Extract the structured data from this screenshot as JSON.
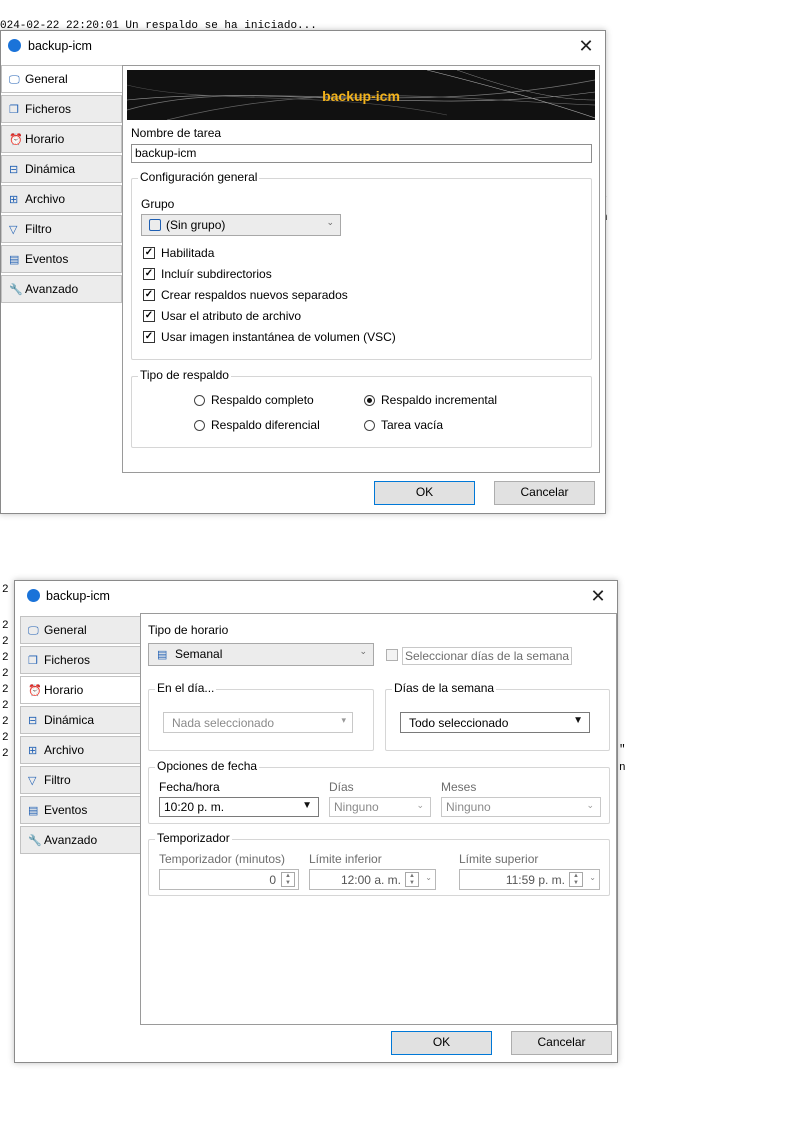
{
  "background_log": {
    "top_line": "024-02-22 22:20:01 Un respaldo se ha iniciado...",
    "right_fragments": [
      "\"",
      "n"
    ],
    "left_gutter_char": "2"
  },
  "dialog1": {
    "title": "backup-icm",
    "close_glyph": "✕",
    "tabs": [
      {
        "label": "General",
        "icon": "monitor-icon"
      },
      {
        "label": "Ficheros",
        "icon": "files-icon"
      },
      {
        "label": "Horario",
        "icon": "alarm-clock-icon"
      },
      {
        "label": "Dinámica",
        "icon": "dynamic-icon"
      },
      {
        "label": "Archivo",
        "icon": "archive-icon"
      },
      {
        "label": "Filtro",
        "icon": "filter-icon"
      },
      {
        "label": "Eventos",
        "icon": "calendar-icon"
      },
      {
        "label": "Avanzado",
        "icon": "wrench-icon"
      }
    ],
    "banner_text": "backup-icm",
    "task_name_label": "Nombre de tarea",
    "task_name_value": "backup-icm",
    "general_config": {
      "title": "Configuración general",
      "group_label": "Grupo",
      "group_value": "(Sin grupo)",
      "checkboxes": [
        {
          "label": "Habilitada",
          "checked": true
        },
        {
          "label": "Incluír subdirectorios",
          "checked": true
        },
        {
          "label": "Crear respaldos nuevos separados",
          "checked": true
        },
        {
          "label": "Usar el atributo de archivo",
          "checked": true
        },
        {
          "label": "Usar imagen instantánea de volumen (VSC)",
          "checked": true
        }
      ]
    },
    "backup_type": {
      "title": "Tipo de respaldo",
      "options": [
        {
          "label": "Respaldo completo",
          "selected": false
        },
        {
          "label": "Respaldo incremental",
          "selected": true
        },
        {
          "label": "Respaldo diferencial",
          "selected": false
        },
        {
          "label": "Tarea vacía",
          "selected": false
        }
      ]
    },
    "ok_label": "OK",
    "cancel_label": "Cancelar"
  },
  "dialog2": {
    "title": "backup-icm",
    "close_glyph": "✕",
    "tabs": [
      {
        "label": "General"
      },
      {
        "label": "Ficheros"
      },
      {
        "label": "Horario"
      },
      {
        "label": "Dinámica"
      },
      {
        "label": "Archivo"
      },
      {
        "label": "Filtro"
      },
      {
        "label": "Eventos"
      },
      {
        "label": "Avanzado"
      }
    ],
    "schedule_type_label": "Tipo de horario",
    "schedule_type_value": "Semanal",
    "select_weekdays_label": "Seleccionar días de la semana",
    "on_day": {
      "title": "En el día...",
      "value": "Nada seleccionado"
    },
    "weekdays": {
      "title": "Días de la semana",
      "value": "Todo seleccionado"
    },
    "date_options": {
      "title": "Opciones de fecha",
      "datetime_label": "Fecha/hora",
      "datetime_value": "10:20 p. m.",
      "days_label": "Días",
      "days_value": "Ninguno",
      "months_label": "Meses",
      "months_value": "Ninguno"
    },
    "timer": {
      "title": "Temporizador",
      "minutes_label": "Temporizador (minutos)",
      "minutes_value": "0",
      "lower_label": "Límite inferior",
      "lower_value": "12:00 a. m.",
      "upper_label": "Límite superior",
      "upper_value": "11:59 p. m."
    },
    "ok_label": "OK",
    "cancel_label": "Cancelar"
  }
}
